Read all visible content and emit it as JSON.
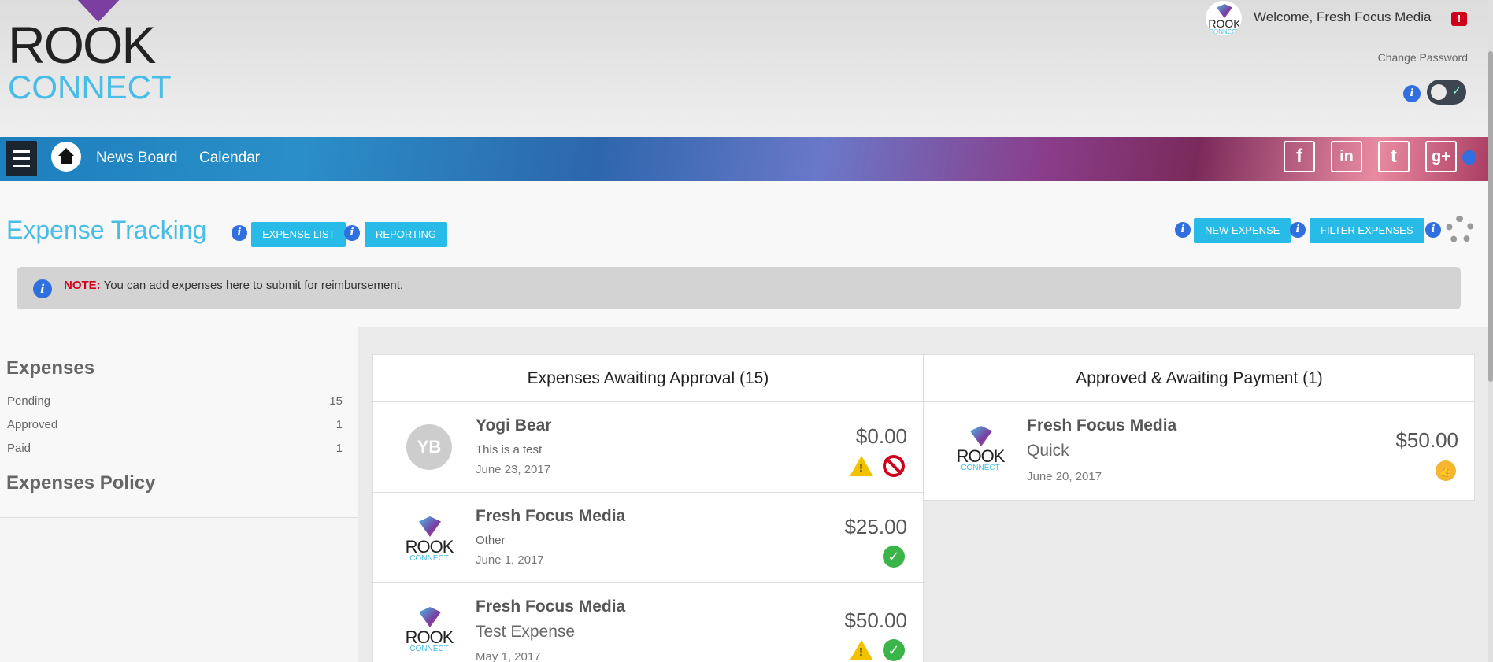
{
  "brand": {
    "line1": "ROOK",
    "line2": "CONNECT"
  },
  "header": {
    "welcome": "Welcome, Fresh Focus Media",
    "alert_badge": "!",
    "change_password": "Change Password",
    "info_glyph": "i",
    "toggle_check": "✓",
    "avatar_line1": "ROOK",
    "avatar_line2": "CONNECT"
  },
  "nav": {
    "links": [
      "News Board",
      "Calendar"
    ],
    "social": [
      {
        "name": "facebook-icon",
        "glyph": "f"
      },
      {
        "name": "linkedin-icon",
        "glyph": "in"
      },
      {
        "name": "twitter-icon",
        "glyph": "t"
      },
      {
        "name": "google-plus-icon",
        "glyph": "g+"
      }
    ]
  },
  "page": {
    "title": "Expense Tracking",
    "buttons": {
      "expense_list": "EXPENSE LIST",
      "reporting": "REPORTING",
      "new_expense": "NEW EXPENSE",
      "filter_expenses": "FILTER EXPENSES"
    },
    "note_label": "NOTE:",
    "note_text": " You can add expenses here to submit for reimbursement."
  },
  "sidebar": {
    "title": "Expenses",
    "items": [
      {
        "label": "Pending",
        "count": "15"
      },
      {
        "label": "Approved",
        "count": "1"
      },
      {
        "label": "Paid",
        "count": "1"
      }
    ],
    "policy": "Expenses Policy"
  },
  "awaiting_approval": {
    "title": "Expenses Awaiting Approval (15)",
    "items": [
      {
        "initials": "YB",
        "name": "Yogi Bear",
        "desc": "This is a test",
        "date": "June 23, 2017",
        "amount": "$0.00"
      },
      {
        "name": "Fresh Focus Media",
        "desc": "Other",
        "date": "June 1, 2017",
        "amount": "$25.00"
      },
      {
        "name": "Fresh Focus Media",
        "desc": "Test Expense",
        "date": "May 1, 2017",
        "amount": "$50.00"
      }
    ]
  },
  "approved": {
    "title": "Approved & Awaiting Payment (1)",
    "items": [
      {
        "name": "Fresh Focus Media",
        "desc": "Quick",
        "date": "June 20, 2017",
        "amount": "$50.00"
      }
    ]
  },
  "colors": {
    "accent": "#29bbe8",
    "title": "#47bde8",
    "warn": "#f2c200",
    "ok": "#3bb54a",
    "deny": "#d0021b"
  }
}
